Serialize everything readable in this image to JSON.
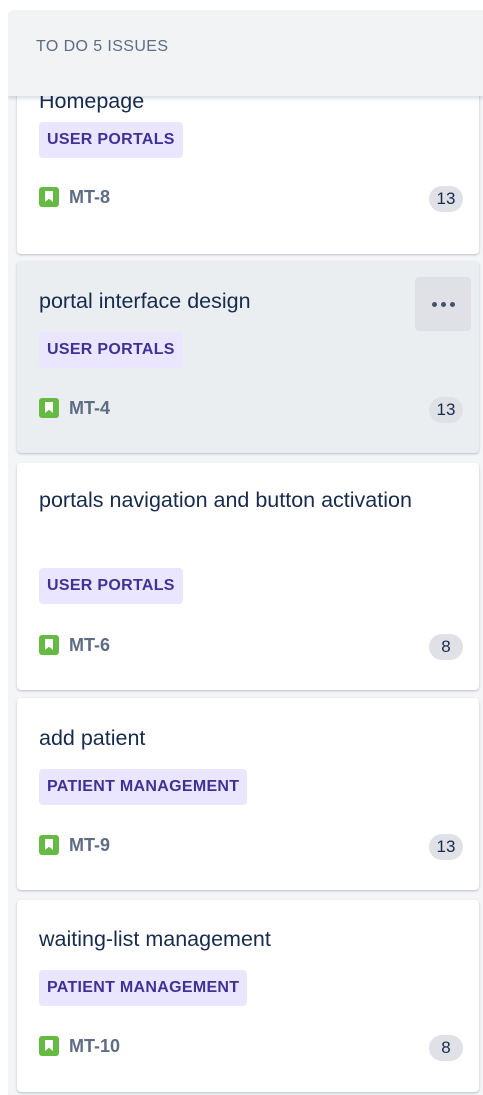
{
  "column": {
    "header": "TO DO 5 ISSUES"
  },
  "cards": [
    {
      "summary": "Homepage",
      "epic": "USER PORTALS",
      "key": "MT-8",
      "points": "13"
    },
    {
      "summary": "portal interface design",
      "epic": "USER PORTALS",
      "key": "MT-4",
      "points": "13"
    },
    {
      "summary": "portals navigation and button activation",
      "epic": "USER PORTALS",
      "key": "MT-6",
      "points": "8"
    },
    {
      "summary": "add patient",
      "epic": "PATIENT MANAGEMENT",
      "key": "MT-9",
      "points": "13"
    },
    {
      "summary": "waiting-list management",
      "epic": "PATIENT MANAGEMENT",
      "key": "MT-10",
      "points": "8"
    }
  ],
  "icons": {
    "issue_type": "story-icon",
    "card_actions": "more-horizontal-icon"
  },
  "colors": {
    "epic_bg": "#eae6ff",
    "epic_text": "#403294",
    "story_icon": "#65ba43"
  }
}
